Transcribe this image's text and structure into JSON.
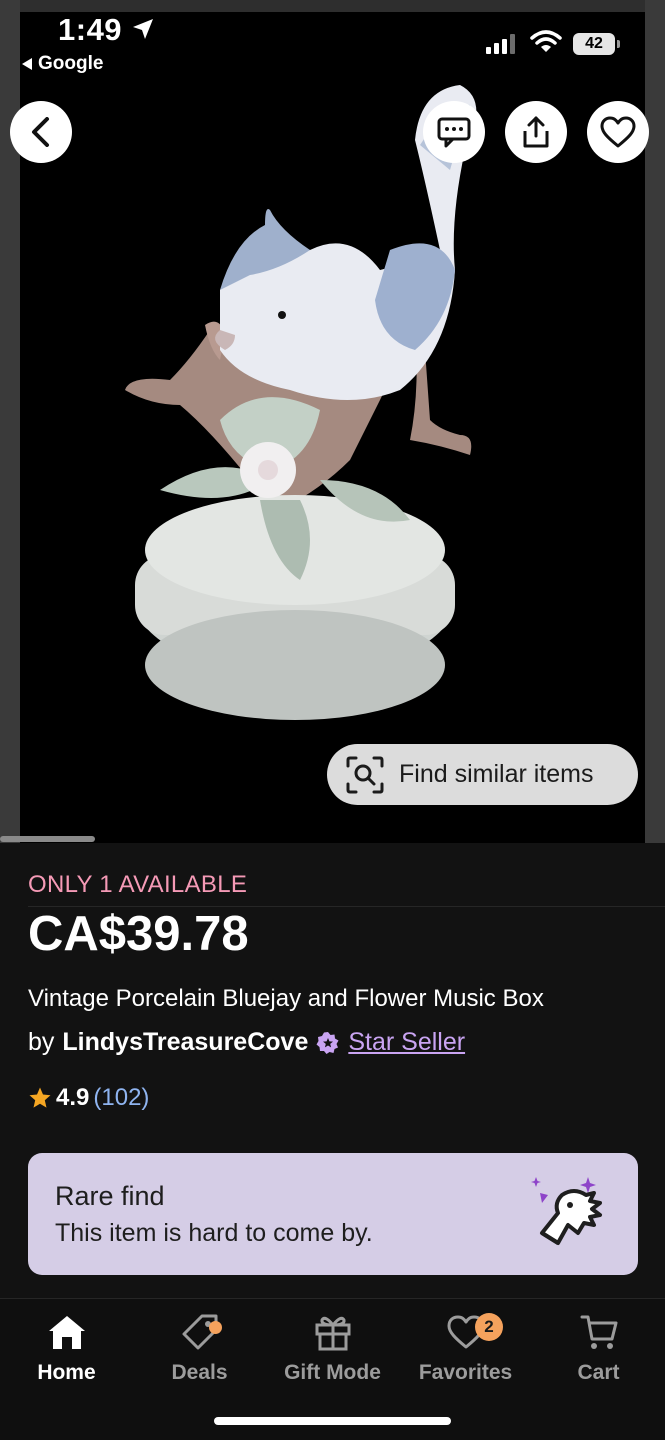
{
  "status_bar": {
    "time": "1:49",
    "back_app": "Google",
    "battery": "42"
  },
  "image_overlay": {
    "find_similar_label": "Find similar items"
  },
  "listing": {
    "availability": "ONLY 1 AVAILABLE",
    "price": "CA$39.78",
    "title": "Vintage Porcelain Bluejay and Flower Music Box",
    "by_prefix": "by",
    "shop_name": "LindysTreasureCove",
    "seller_badge": "Star Seller",
    "rating": "4.9",
    "review_count": "(102)"
  },
  "rare_find": {
    "heading": "Rare find",
    "subtext": "This item is hard to come by."
  },
  "tab_bar": {
    "tabs": [
      {
        "label": "Home",
        "icon": "home-icon",
        "active": true
      },
      {
        "label": "Deals",
        "icon": "tag-icon",
        "active": false
      },
      {
        "label": "Gift Mode",
        "icon": "gift-icon",
        "active": false
      },
      {
        "label": "Favorites",
        "icon": "heart-icon",
        "active": false,
        "badge": "2"
      },
      {
        "label": "Cart",
        "icon": "cart-icon",
        "active": false
      }
    ]
  },
  "colors": {
    "availability": "#f59ab6",
    "star_seller": "#c9a4f2",
    "review_count": "#8fb4f0",
    "rare_card": "#d5cde6",
    "badge": "#f5a25d"
  }
}
